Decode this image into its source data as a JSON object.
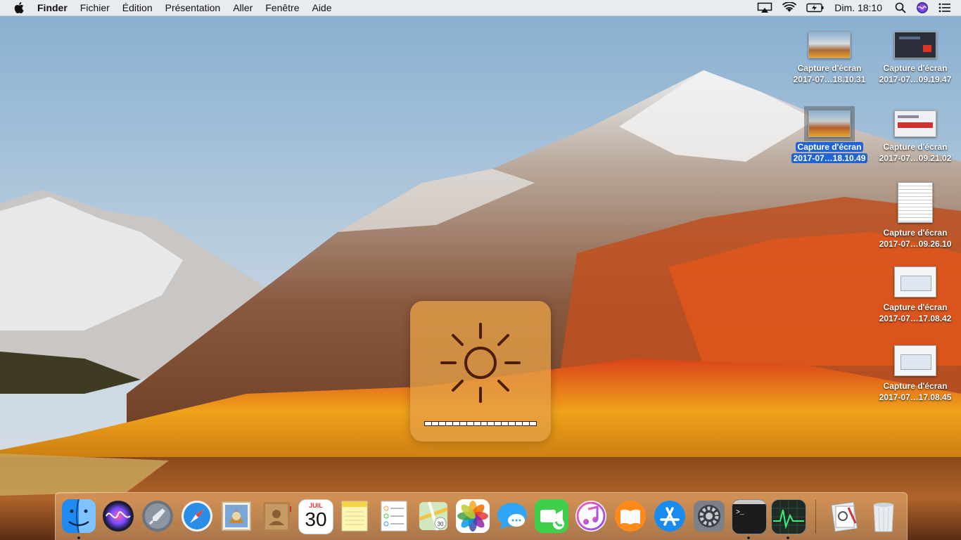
{
  "menubar": {
    "apple_icon": "apple-icon",
    "items": [
      "Finder",
      "Fichier",
      "Édition",
      "Présentation",
      "Aller",
      "Fenêtre",
      "Aide"
    ],
    "status_icons": [
      "airplay-icon",
      "wifi-icon",
      "battery-icon"
    ],
    "clock": "Dim. 18:10",
    "right_icons": [
      "search-icon",
      "siri-icon",
      "notification-center-icon"
    ]
  },
  "desktop_icons": [
    {
      "line1": "Capture d'écran",
      "line2": "2017-07…18.10.31",
      "selected": false
    },
    {
      "line1": "Capture d'écran",
      "line2": "2017-07…09.19.47",
      "selected": false
    },
    {
      "line1": "Capture d'écran",
      "line2": "2017-07…18.10.49",
      "selected": true
    },
    {
      "line1": "Capture d'écran",
      "line2": "2017-07…09.21.02",
      "selected": false
    },
    {
      "line1": "Capture d'écran",
      "line2": "2017-07…09.26.10",
      "selected": false
    },
    {
      "line1": "Capture d'écran",
      "line2": "2017-07…17.08.42",
      "selected": false
    },
    {
      "line1": "Capture d'écran",
      "line2": "2017-07…17.08.45",
      "selected": false
    }
  ],
  "hud": {
    "icon": "brightness-sun-icon",
    "level": 1.0,
    "segments": 16
  },
  "dock": {
    "apps": [
      {
        "name": "Finder",
        "icon": "finder-icon",
        "running": true
      },
      {
        "name": "Siri",
        "icon": "siri-icon",
        "running": false
      },
      {
        "name": "Launchpad",
        "icon": "launchpad-icon",
        "running": false
      },
      {
        "name": "Safari",
        "icon": "safari-icon",
        "running": false
      },
      {
        "name": "Mail",
        "icon": "mail-icon",
        "running": false
      },
      {
        "name": "Contacts",
        "icon": "contacts-icon",
        "running": false
      },
      {
        "name": "Calendrier",
        "icon": "calendar-icon",
        "running": false,
        "month": "JUIL",
        "day": "30"
      },
      {
        "name": "Notes",
        "icon": "notes-icon",
        "running": false
      },
      {
        "name": "Rappels",
        "icon": "reminders-icon",
        "running": false
      },
      {
        "name": "Plans",
        "icon": "maps-icon",
        "running": false
      },
      {
        "name": "Photos",
        "icon": "photos-icon",
        "running": false
      },
      {
        "name": "Messages",
        "icon": "messages-icon",
        "running": false
      },
      {
        "name": "FaceTime",
        "icon": "facetime-icon",
        "running": false
      },
      {
        "name": "iTunes",
        "icon": "itunes-icon",
        "running": false
      },
      {
        "name": "iBooks",
        "icon": "ibooks-icon",
        "running": false
      },
      {
        "name": "App Store",
        "icon": "app-store-icon",
        "running": false
      },
      {
        "name": "Préférences Système",
        "icon": "system-preferences-icon",
        "running": false
      },
      {
        "name": "Terminal",
        "icon": "terminal-icon",
        "running": true
      },
      {
        "name": "Moniteur d'activité",
        "icon": "activity-monitor-icon",
        "running": true
      }
    ],
    "others": [
      {
        "name": "Aperçu",
        "icon": "preview-icon"
      },
      {
        "name": "Corbeille",
        "icon": "trash-icon"
      }
    ]
  }
}
